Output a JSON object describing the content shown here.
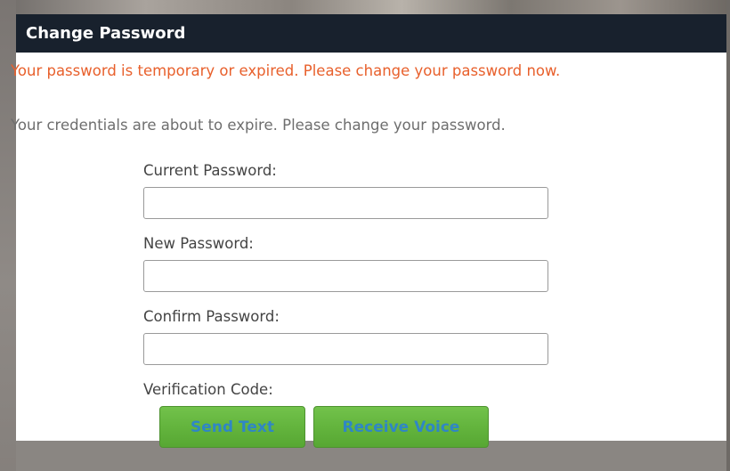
{
  "dialog": {
    "title": "Change Password",
    "error_message": "Your password is temporary or expired. Please change your password now.",
    "info_message": "Your credentials are about to expire. Please change your password."
  },
  "form": {
    "current_password_label": "Current Password:",
    "new_password_label": "New Password:",
    "confirm_password_label": "Confirm Password:",
    "verification_code_label": "Verification Code:"
  },
  "buttons": {
    "send_text": "Send Text",
    "receive_voice": "Receive Voice"
  },
  "colors": {
    "titlebar": "#18212d",
    "error_text": "#e8602c",
    "button_green": "#62b33c",
    "button_text": "#2f86c6"
  }
}
